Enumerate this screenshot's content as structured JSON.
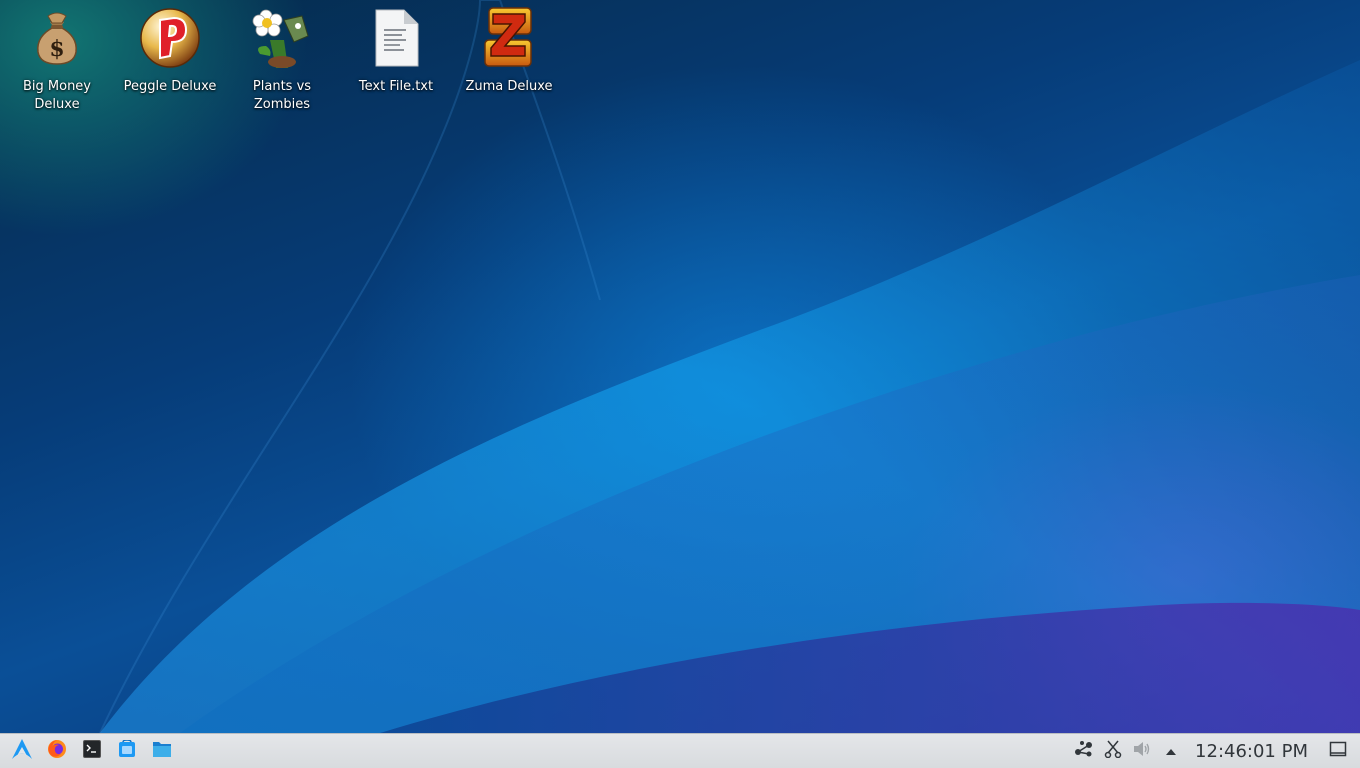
{
  "desktop": {
    "icons": [
      {
        "label": "Big Money Deluxe",
        "icon": "money-bag-icon"
      },
      {
        "label": "Peggle Deluxe",
        "icon": "peggle-icon"
      },
      {
        "label": "Plants vs Zombies",
        "icon": "plants-vs-zombies-icon"
      },
      {
        "label": "Text File.txt",
        "icon": "text-file-icon"
      },
      {
        "label": "Zuma Deluxe",
        "icon": "zuma-icon"
      }
    ]
  },
  "taskbar": {
    "launchers": [
      {
        "name": "Application Launcher",
        "icon": "arch-launcher-icon"
      },
      {
        "name": "Firefox",
        "icon": "firefox-icon"
      },
      {
        "name": "Terminal",
        "icon": "terminal-icon"
      },
      {
        "name": "Discover",
        "icon": "store-icon"
      },
      {
        "name": "File Manager",
        "icon": "folder-icon"
      }
    ],
    "tray": [
      {
        "name": "Network",
        "icon": "network-icon"
      },
      {
        "name": "Clipboard",
        "icon": "scissors-icon"
      },
      {
        "name": "Volume",
        "icon": "volume-icon"
      },
      {
        "name": "Show hidden icons",
        "icon": "chevron-up-icon"
      }
    ],
    "clock": "12:46:01 PM",
    "show_desktop_icon": "show-desktop-icon"
  },
  "colors": {
    "taskbar_bg": "#dfe2e5",
    "launcher_accent": "#1d99f3",
    "wallpaper_blue": "#0a4f97",
    "wallpaper_purple": "#a028be"
  }
}
